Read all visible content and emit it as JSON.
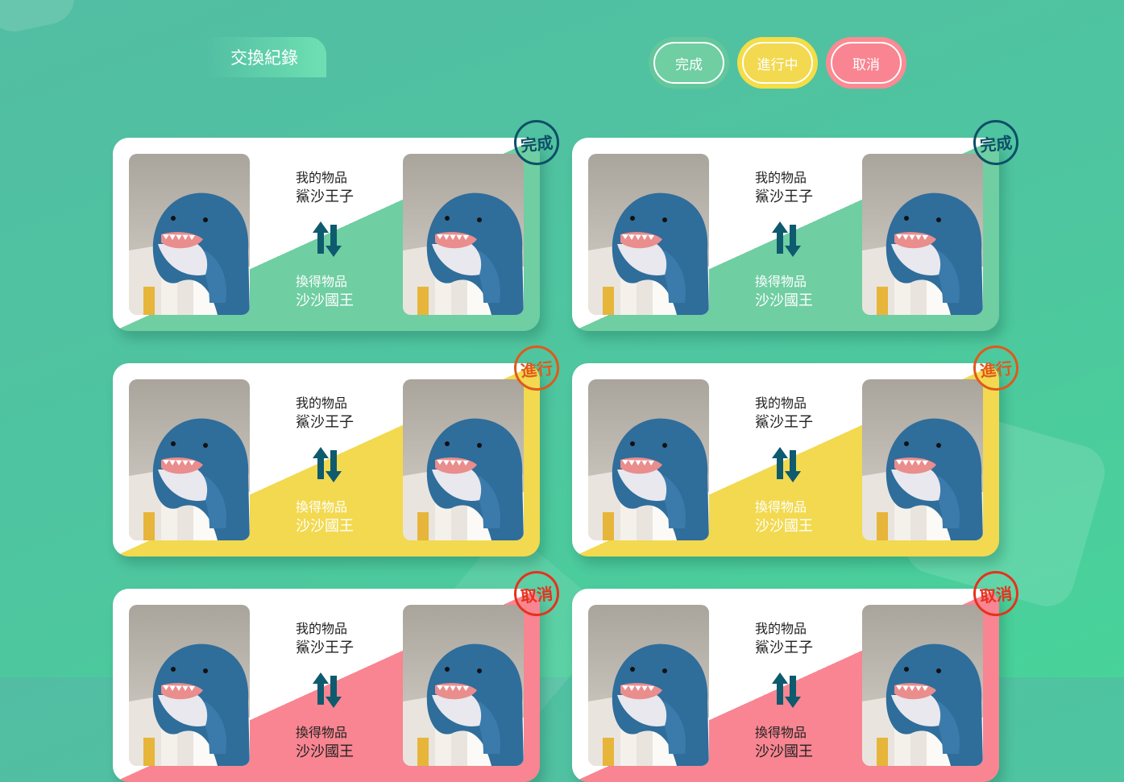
{
  "header": {
    "title": "交換紀錄"
  },
  "filters": {
    "done": "完成",
    "in_progress": "進行中",
    "cancelled": "取消"
  },
  "labels": {
    "my_item": "我的物品",
    "received_item": "換得物品"
  },
  "colors": {
    "done": "#6fcea2",
    "in_progress": "#f2d94f",
    "cancelled": "#f88591",
    "stamp_done": "#0d4f67",
    "stamp_progress": "#e0591c",
    "stamp_cancel": "#e6321d"
  },
  "cards": [
    {
      "status": "done",
      "stamp": "完成",
      "my_item": "鯊沙王子",
      "received_item": "沙沙國王",
      "swap_icon": "swap-arrows-icon",
      "image": "shark-plush-photo"
    },
    {
      "status": "done",
      "stamp": "完成",
      "my_item": "鯊沙王子",
      "received_item": "沙沙國王",
      "swap_icon": "swap-arrows-icon",
      "image": "shark-plush-photo"
    },
    {
      "status": "in_progress",
      "stamp": "進行",
      "my_item": "鯊沙王子",
      "received_item": "沙沙國王",
      "swap_icon": "swap-arrows-icon",
      "image": "shark-plush-photo"
    },
    {
      "status": "in_progress",
      "stamp": "進行",
      "my_item": "鯊沙王子",
      "received_item": "沙沙國王",
      "swap_icon": "swap-arrows-icon",
      "image": "shark-plush-photo"
    },
    {
      "status": "cancelled",
      "stamp": "取消",
      "my_item": "鯊沙王子",
      "received_item": "沙沙國王",
      "swap_icon": "swap-arrows-icon",
      "image": "shark-plush-photo"
    },
    {
      "status": "cancelled",
      "stamp": "取消",
      "my_item": "鯊沙王子",
      "received_item": "沙沙國王",
      "swap_icon": "swap-arrows-icon",
      "image": "shark-plush-photo"
    }
  ]
}
